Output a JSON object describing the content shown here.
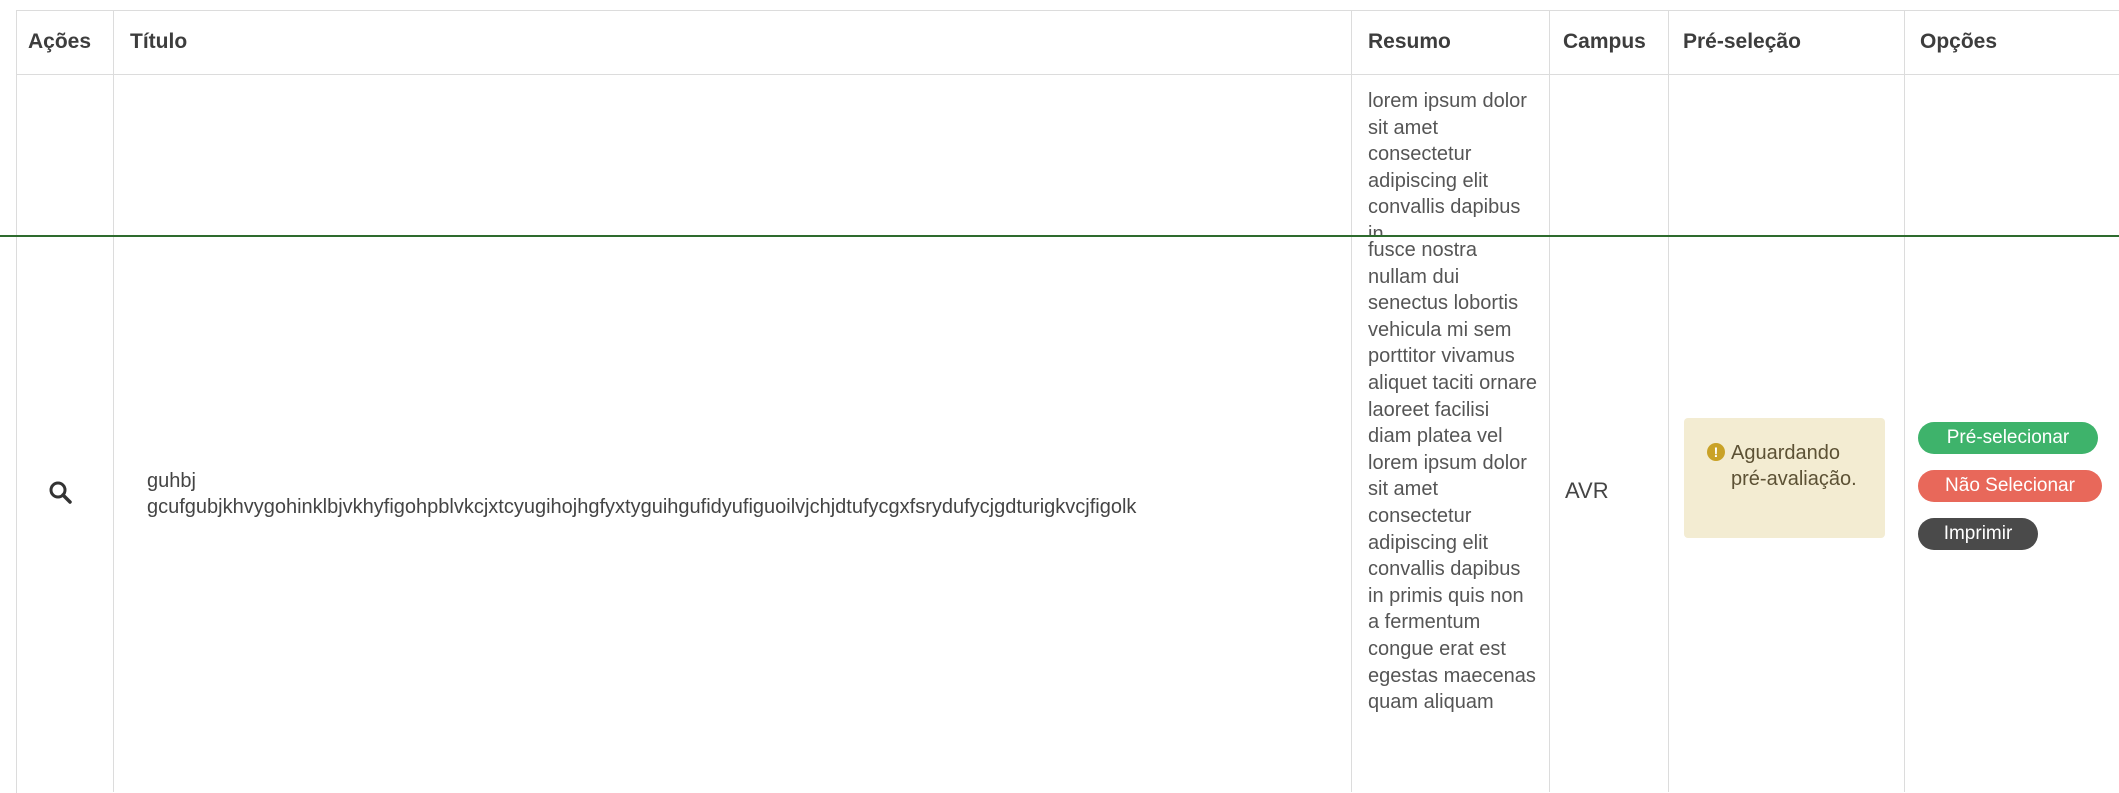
{
  "table": {
    "headers": {
      "acoes": "Ações",
      "titulo": "Título",
      "resumo": "Resumo",
      "campus": "Campus",
      "pre_selecao": "Pré-seleção",
      "opcoes": "Opções"
    },
    "row_top": {
      "resumo": "lorem ipsum dolor sit amet consectetur adipiscing elit convallis dapibus in"
    },
    "row_main": {
      "titulo_line1": "guhbj",
      "titulo_line2": "gcufgubjkhvygohinklbjvkhyfigohpblvkcjxtcyugihojhgfyxtyguihgufidyufiguoilvjchjdtufycgxfsrydufycjgdturigkvcjfigolk",
      "resumo": "fusce nostra nullam dui senectus lobortis vehicula mi sem porttitor vivamus aliquet taciti ornare laoreet facilisi diam platea vel lorem ipsum dolor sit amet consectetur adipiscing elit convallis dapibus in primis quis non a fermentum congue erat est egestas maecenas quam aliquam",
      "campus": "AVR",
      "status": "Aguardando pré-avaliação.",
      "status_icon": "exclamation-icon",
      "buttons": {
        "preselect": "Pré-selecionar",
        "nao_selecionar": "Não Selecionar",
        "imprimir": "Imprimir"
      }
    }
  },
  "colors": {
    "preselect": "#3eb36b",
    "nao_selecionar": "#e8685a",
    "imprimir": "#4a4a4a",
    "status_bg": "#f3ecd2",
    "divider": "#2e6b2e"
  }
}
